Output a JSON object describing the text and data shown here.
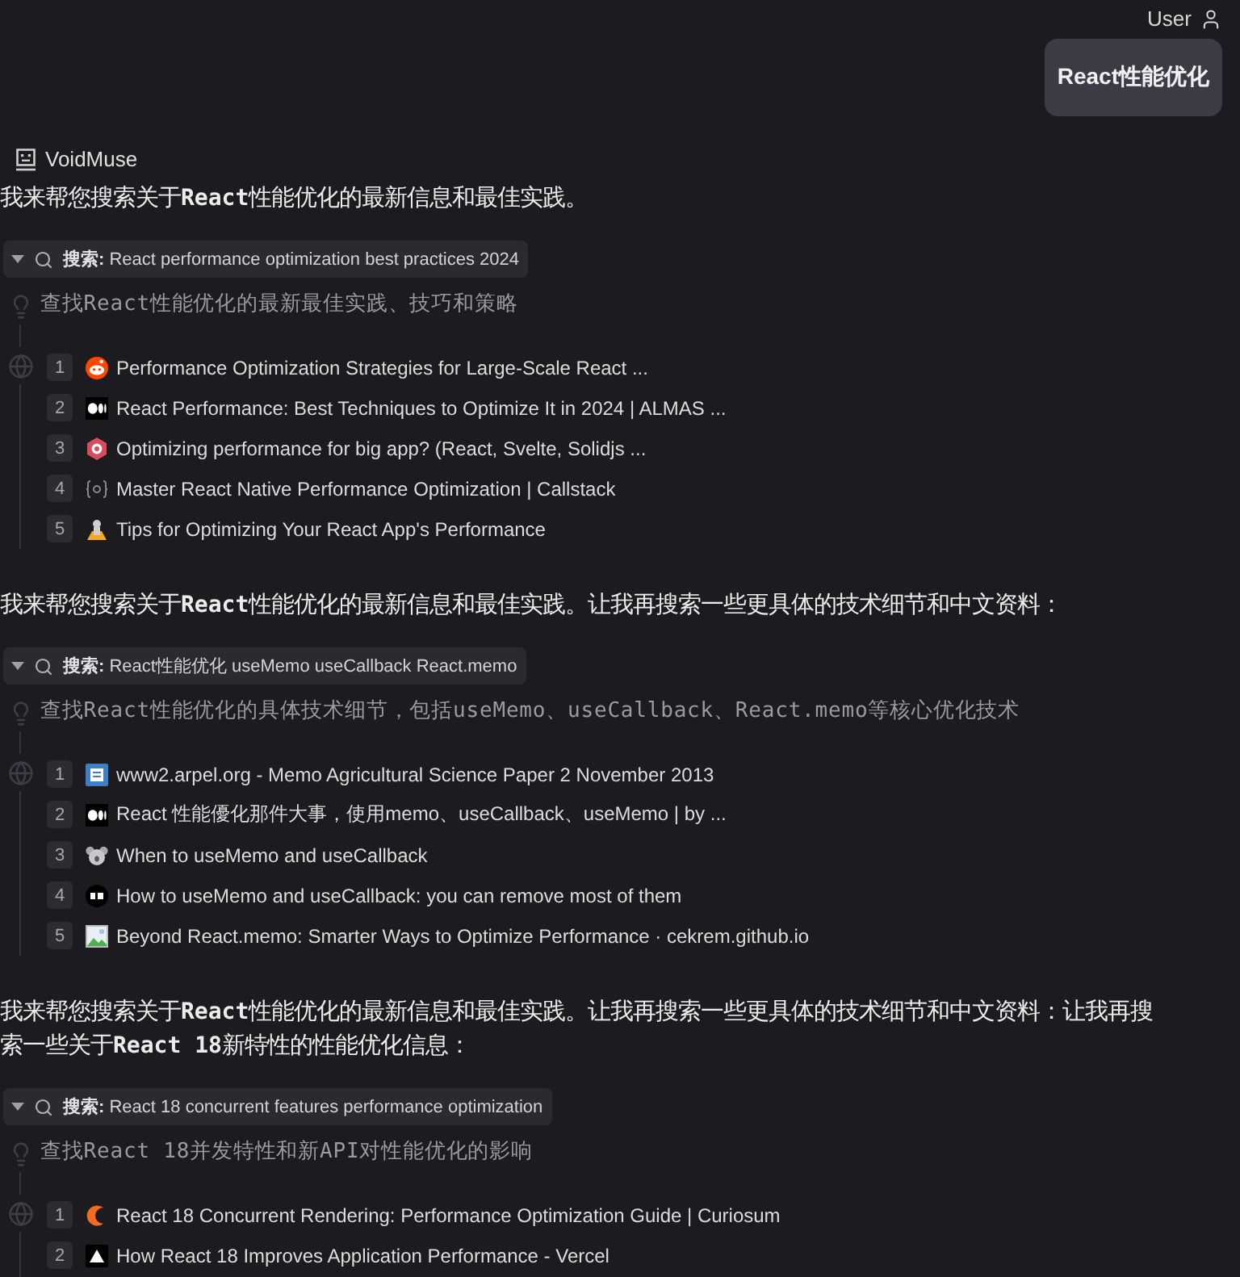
{
  "header": {
    "user_label": "User"
  },
  "user_message": {
    "text": "React性能优化"
  },
  "assistant": {
    "name": "VoidMuse"
  },
  "sections": [
    {
      "text": "我来帮您搜索关于**React**性能优化的最新信息和最佳实践。",
      "search": {
        "expanded": true,
        "label": "搜索:",
        "query": "React performance optimization best practices 2024",
        "description": "查找React性能优化的最新最佳实践、技巧和策略",
        "results": [
          {
            "number": "1",
            "kind": "alien",
            "title": "Performance Optimization Strategies for Large-Scale React ..."
          },
          {
            "number": "2",
            "kind": "ellipses",
            "title": "React Performance: Best Techniques to Optimize It in 2024 | ALMAS ..."
          },
          {
            "number": "3",
            "kind": "hexagon",
            "title": "Optimizing performance for big app? (React, Svelte, Solidjs ..."
          },
          {
            "number": "4",
            "kind": "braces",
            "title": "Master React Native Performance Optimization | Callstack"
          },
          {
            "number": "5",
            "kind": "cone",
            "title": "Tips for Optimizing Your React App's Performance"
          }
        ]
      }
    },
    {
      "text": "我来帮您搜索关于**React**性能优化的最新信息和最佳实践。让我再搜索一些更具体的技术细节和中文资料：",
      "search": {
        "expanded": true,
        "label": "搜索:",
        "query": "React性能优化 useMemo useCallback React.memo",
        "description": "查找React性能优化的具体技术细节，包括useMemo、useCallback、React.memo等核心优化技术",
        "results": [
          {
            "number": "1",
            "kind": "document",
            "title": "www2.arpel.org - Memo Agricultural Science Paper 2 November 2013"
          },
          {
            "number": "2",
            "kind": "ellipses",
            "title": "React 性能優化那件大事，使用memo、useCallback、useMemo | by ..."
          },
          {
            "number": "3",
            "kind": "animal",
            "title": "When to useMemo and useCallback"
          },
          {
            "number": "4",
            "kind": "monogram",
            "title": "How to useMemo and useCallback: you can remove most of them"
          },
          {
            "number": "5",
            "kind": "image",
            "title": "Beyond React.memo: Smarter Ways to Optimize Performance · cekrem.github.io"
          }
        ]
      }
    },
    {
      "text": "我来帮您搜索关于**React**性能优化的最新信息和最佳实践。让我再搜索一些更具体的技术细节和中文资料：让我再搜索一些关于**React 18**新特性的性能优化信息：",
      "search": {
        "expanded": true,
        "label": "搜索:",
        "query": "React 18 concurrent features performance optimization",
        "description": "查找React 18并发特性和新API对性能优化的影响",
        "results": [
          {
            "number": "1",
            "kind": "crescent",
            "title": "React 18 Concurrent Rendering: Performance Optimization Guide | Curiosum"
          },
          {
            "number": "2",
            "kind": "triangle",
            "title": "How React 18 Improves Application Performance - Vercel"
          }
        ]
      }
    }
  ]
}
